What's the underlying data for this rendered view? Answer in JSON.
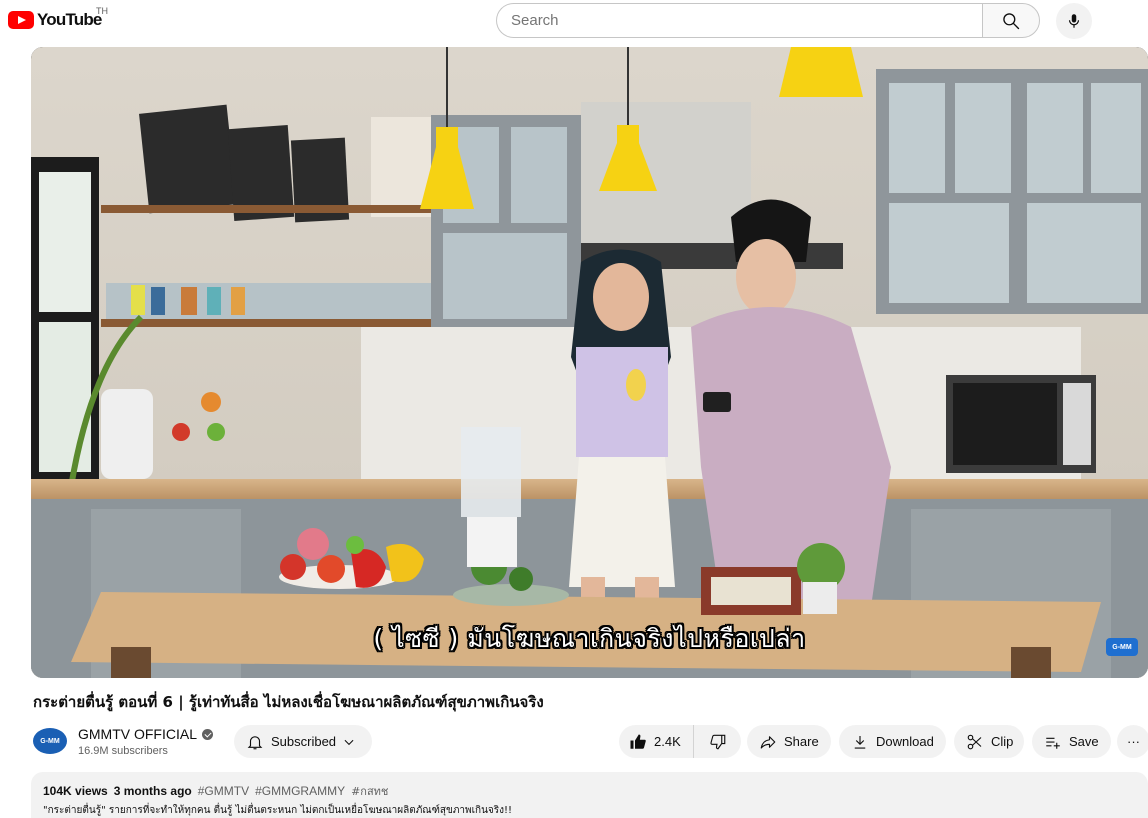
{
  "header": {
    "logo_text": "YouTube",
    "country_code": "TH",
    "search_placeholder": "Search",
    "icons": [
      "youtube-logo-icon",
      "search-icon",
      "microphone-icon"
    ]
  },
  "player": {
    "subtitle": "( ไซซี ) มันโฆษณาเกินจริงไปหรือเปล่า",
    "watermark": "G-MM"
  },
  "video": {
    "title": "กระต่ายตื่นรู้ ตอนที่ 6 | รู้เท่าทันสื่อ ไม่หลงเชื่อโฆษณาผลิตภัณฑ์สุขภาพเกินจริง"
  },
  "channel": {
    "avatar_text": "G-MM",
    "name": "GMMTV OFFICIAL",
    "subscribers": "16.9M subscribers",
    "subscribed_label": "Subscribed"
  },
  "actions": {
    "like_count": "2.4K",
    "share_label": "Share",
    "download_label": "Download",
    "clip_label": "Clip",
    "save_label": "Save",
    "more_label": "···"
  },
  "description": {
    "views": "104K views",
    "age": "3 months ago",
    "hashtags": [
      "#GMMTV",
      "#GMMGRAMMY",
      "#กสทช"
    ],
    "text": "\"กระต่ายตื่นรู้\" รายการที่จะทำให้ทุกคน ตื่นรู้ ไม่ตื่นตระหนก ไม่ตกเป็นเหยื่อโฆษณาผลิตภัณฑ์สุขภาพเกินจริง!!"
  },
  "colors": {
    "brand_red": "#ff0000",
    "chip_bg": "#f2f2f2",
    "text_primary": "#0f0f0f",
    "text_secondary": "#606060"
  }
}
